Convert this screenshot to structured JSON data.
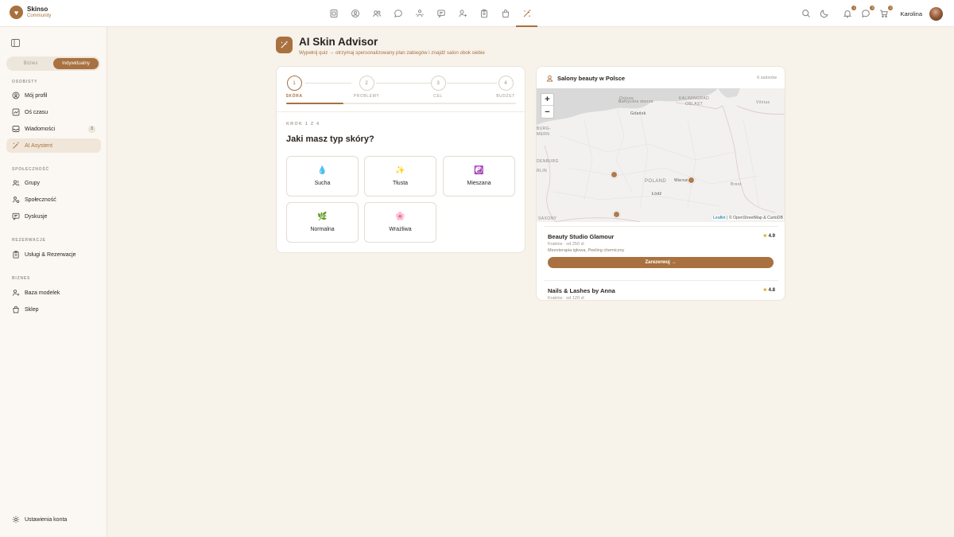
{
  "brand": {
    "name": "Skinso",
    "subtitle": "Community"
  },
  "top_nav": [
    {
      "icon": "dashboard-icon"
    },
    {
      "icon": "profile-icon"
    },
    {
      "icon": "users-icon"
    },
    {
      "icon": "chat-icon"
    },
    {
      "icon": "community-icon"
    },
    {
      "icon": "discussion-icon"
    },
    {
      "icon": "models-icon"
    },
    {
      "icon": "clipboard-icon"
    },
    {
      "icon": "shop-icon"
    },
    {
      "icon": "ai-wand-icon",
      "active": true
    }
  ],
  "top_right": {
    "notifications_badge": "1",
    "messages_badge": "3",
    "cart_badge": "2",
    "user_name": "Karolina"
  },
  "sidebar": {
    "segment": {
      "options": [
        "Biznes",
        "Indywidualny"
      ],
      "selected": "Indywidualny"
    },
    "sections": {
      "personal": "OSOBISTY",
      "community": "SPOŁECZNOŚĆ",
      "reservations": "REZERWACJE",
      "business": "BIZNES"
    },
    "items": {
      "profile": "Mój profil",
      "timeline": "Oś czasu",
      "messages": "Wiadomości",
      "messages_badge": "3",
      "ai": "AI Asystent",
      "groups": "Grupy",
      "community": "Społeczność",
      "discussions": "Dyskusje",
      "services": "Usługi & Rezerwacje",
      "models": "Baza modelek",
      "shop": "Sklep",
      "settings": "Ustawienia konta"
    }
  },
  "page": {
    "title": "AI Skin Advisor",
    "subtitle": "Wypełnij quiz → otrzymaj spersonalizowany plan zabiegów i znajdź salon obok siebie"
  },
  "quiz": {
    "steps": [
      {
        "num": "1",
        "label": "SKÓRA"
      },
      {
        "num": "2",
        "label": "PROBLEMY"
      },
      {
        "num": "3",
        "label": "CEL"
      },
      {
        "num": "4",
        "label": "BUDŻET"
      }
    ],
    "current_step": 1,
    "progress": 0.25,
    "step_counter": "KROK 1 Z 4",
    "question": "Jaki masz typ skóry?",
    "options": [
      {
        "emoji": "💧",
        "label": "Sucha"
      },
      {
        "emoji": "✨",
        "label": "Tłusta"
      },
      {
        "emoji": "☯️",
        "label": "Mieszana"
      },
      {
        "emoji": "🌿",
        "label": "Normalna"
      },
      {
        "emoji": "🌸",
        "label": "Wrażliwa"
      }
    ]
  },
  "map_panel": {
    "title": "Salony beauty w Polsce",
    "count": "6 salonów",
    "zoom_in": "+",
    "zoom_out": "−",
    "labels": {
      "sea": "Bałtyckie morze",
      "ostsee": "Ostsee",
      "kaliningrad": "KALININGRAD OBLAST",
      "vilnius": "Vilnius",
      "gdansk": "Gdańsk",
      "burg": "BURG-MERN",
      "denburg": "DENBURG",
      "berlin": "RLIN",
      "poland": "POLAND",
      "warsaw": "Warsaw",
      "lodz": "Łódź",
      "brest": "Brest",
      "saxony": "SAXONY"
    },
    "attribution_link": "Leaflet",
    "attribution_rest": "| © OpenStreetMap & CartoDB",
    "salons": [
      {
        "name": "Beauty Studio Glamour",
        "meta": "Kraków · od 250 zł",
        "tags": "Mezoterapia igłowa, Peeling chemiczny",
        "rating": "4.9",
        "button": "Zarezerwuj →"
      },
      {
        "name": "Nails & Lashes by Anna",
        "meta": "Kraków · od 120 zł",
        "rating": "4.8"
      }
    ]
  },
  "colors": {
    "accent": "#a8713f",
    "background": "#f7f2ea",
    "sidebar": "#fbf8f3"
  }
}
